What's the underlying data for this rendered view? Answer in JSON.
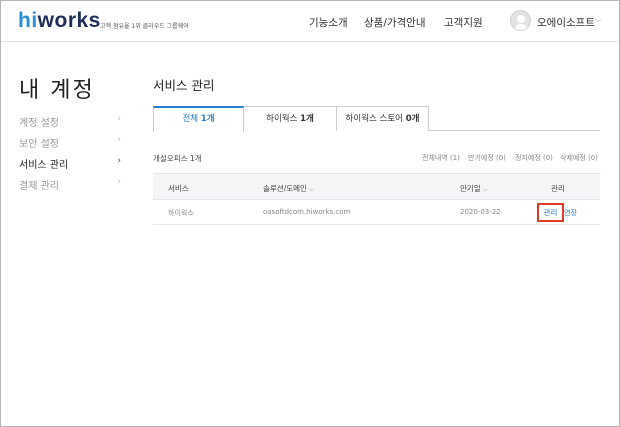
{
  "brand": {
    "logo_hi": "hi",
    "logo_rest": "works",
    "tagline": "고객 점유율 1위 클라우드 그룹웨어"
  },
  "nav": [
    "기능소개",
    "상품/가격안내",
    "고객지원"
  ],
  "user": {
    "name": "오에이소프트",
    "chevron": "⌵"
  },
  "sidebar": {
    "title": "내 계정",
    "items": [
      {
        "label": "계정 설정",
        "active": false
      },
      {
        "label": "보안 설정",
        "active": false
      },
      {
        "label": "서비스 관리",
        "active": true
      },
      {
        "label": "결제 관리",
        "active": false
      }
    ],
    "chevron": "›"
  },
  "main": {
    "title": "서비스 관리",
    "tabs": [
      {
        "label": "전체",
        "count": "1개",
        "active": true
      },
      {
        "label": "하이웍스",
        "count": "1개",
        "active": false
      },
      {
        "label": "하이웍스 스토어",
        "count": "0개",
        "active": false
      }
    ],
    "count_label": "개설오피스 1개",
    "filters": [
      "전체내역 (1)",
      "만기예정 (0)",
      "정지예정 (0)",
      "삭제예정 (0)"
    ],
    "columns": [
      "서비스",
      "솔루션/도메인",
      "만기일",
      "관리"
    ],
    "sort_icon": "⌵",
    "rows": [
      {
        "service": "하이웍스",
        "domain": "oasoftdcom.hiworks.com",
        "expiry": "2020-03-22",
        "manage": "관리",
        "extend": "연장"
      }
    ]
  }
}
